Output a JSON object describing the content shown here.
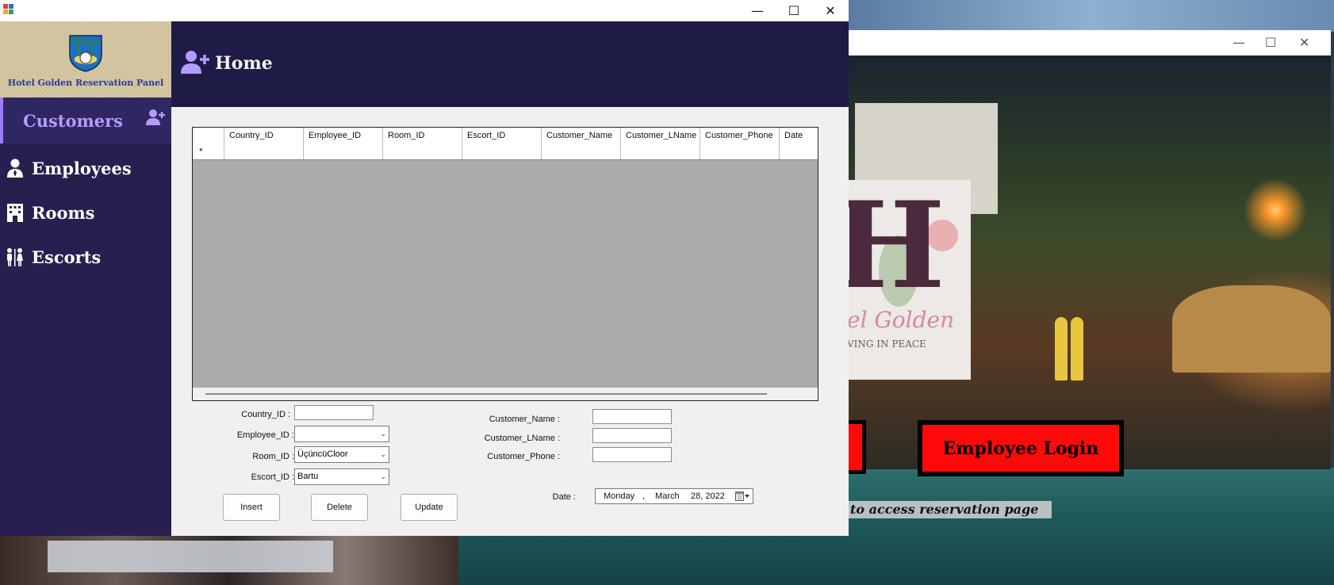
{
  "background": {
    "logo": {
      "script": "el Golden",
      "tagline": "VING IN PEACE"
    },
    "employee_login_label": "Employee Login",
    "access_text": "to access reservation page"
  },
  "titlebar": {
    "minimize": "—",
    "maximize": "☐",
    "close": "✕"
  },
  "sidebar": {
    "brand": "Hotel Golden Reservation Panel",
    "items": [
      {
        "label": "Customers",
        "icon": "user-plus-icon",
        "active": true
      },
      {
        "label": "Employees",
        "icon": "employee-icon"
      },
      {
        "label": "Rooms",
        "icon": "building-icon"
      },
      {
        "label": "Escorts",
        "icon": "people-icon"
      }
    ]
  },
  "header": {
    "title": "Home",
    "icon": "user-plus-icon"
  },
  "grid": {
    "columns": [
      "Country_ID",
      "Employee_ID",
      "Room_ID",
      "Escort_ID",
      "Customer_Name",
      "Customer_LName",
      "Customer_Phone",
      "Date"
    ],
    "new_row_marker": "*"
  },
  "form": {
    "country_id_label": "Country_ID :",
    "country_id_value": "",
    "employee_id_label": "Employee_ID :",
    "employee_id_value": "",
    "room_id_label": "Room_ID :",
    "room_id_value": "ÜçüncüCloor",
    "escort_id_label": "Escort_ID :",
    "escort_id_value": "Bartu",
    "customer_name_label": "Customer_Name :",
    "customer_lname_label": "Customer_LName :",
    "customer_phone_label": "Customer_Phone :",
    "date_label": "Date :",
    "date_weekday": "Monday",
    "date_sep": ",",
    "date_month": "March",
    "date_day_year": "28, 2022",
    "insert": "Insert",
    "delete": "Delete",
    "update": "Update"
  },
  "colors": {
    "sidebar": "#27204f",
    "topbar": "#1f1b47",
    "active_nav": "#b49bff",
    "login_red": "#ff0a0a"
  }
}
